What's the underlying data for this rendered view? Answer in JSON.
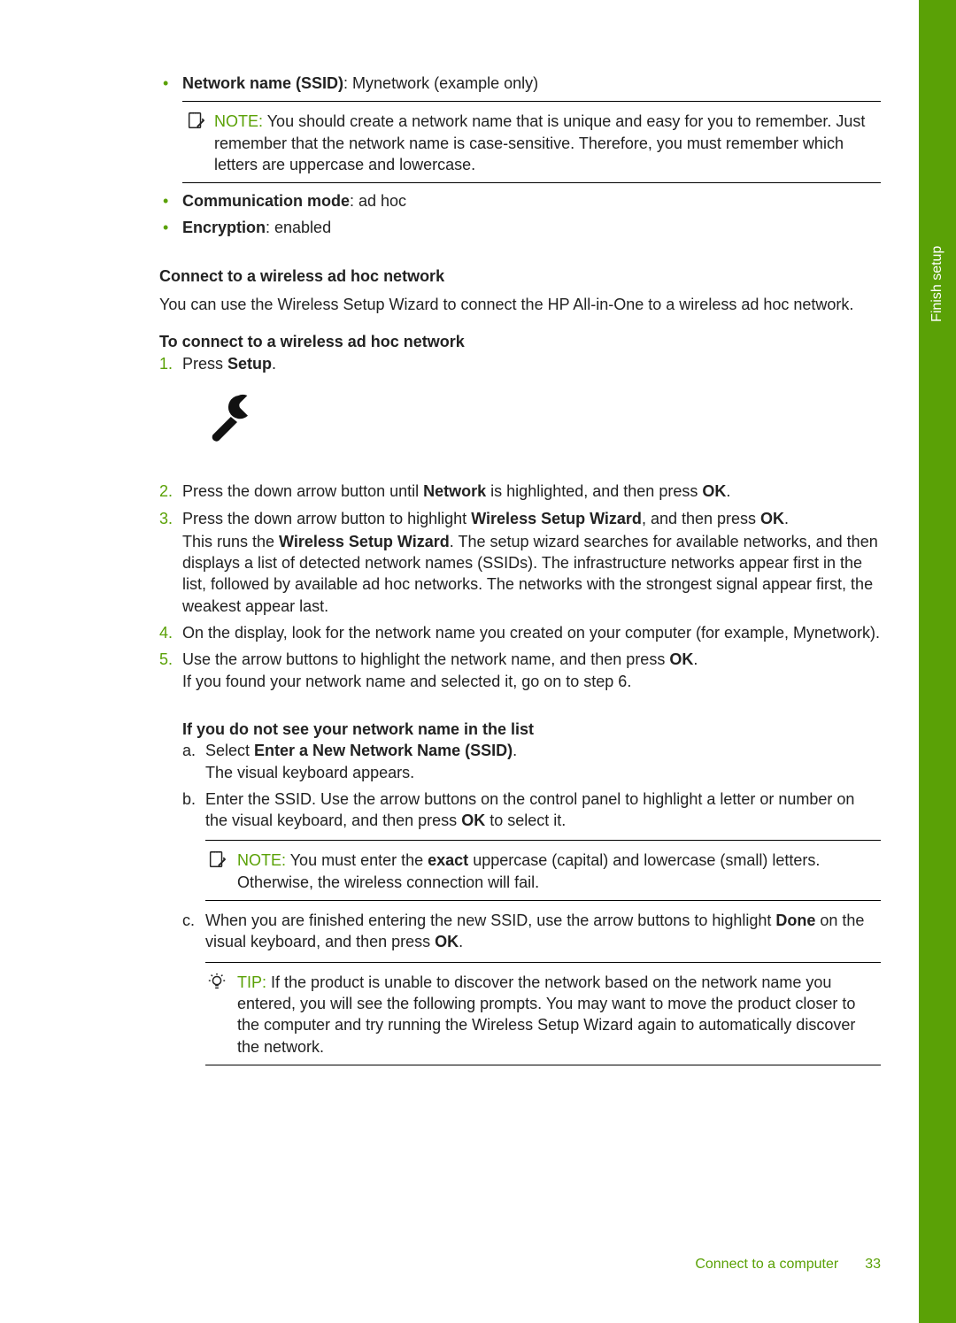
{
  "side_tab": "Finish setup",
  "top_bullets": [
    {
      "label_bold": "Network name (SSID)",
      "value": ": Mynetwork (example only)"
    }
  ],
  "note1": {
    "label": "NOTE:",
    "text": "You should create a network name that is unique and easy for you to remember. Just remember that the network name is case-sensitive. Therefore, you must remember which letters are uppercase and lowercase."
  },
  "top_bullets2": [
    {
      "label_bold": "Communication mode",
      "value": ": ad hoc"
    },
    {
      "label_bold": "Encryption",
      "value": ": enabled"
    }
  ],
  "section_heading": "Connect to a wireless ad hoc network",
  "section_para": "You can use the Wireless Setup Wizard to connect the HP All-in-One to a wireless ad hoc network.",
  "proc_heading": "To connect to a wireless ad hoc network",
  "step1_a": "Press ",
  "step1_b": "Setup",
  "step1_c": ".",
  "step2_a": "Press the down arrow button until ",
  "step2_b": "Network",
  "step2_c": " is highlighted, and then press ",
  "step2_d": "OK",
  "step2_e": ".",
  "step3_a": "Press the down arrow button to highlight ",
  "step3_b": "Wireless Setup Wizard",
  "step3_c": ", and then press ",
  "step3_d": "OK",
  "step3_e": ".",
  "step3_p2a": "This runs the ",
  "step3_p2b": "Wireless Setup Wizard",
  "step3_p2c": ". The setup wizard searches for available networks, and then displays a list of detected network names (SSIDs). The infrastructure networks appear first in the list, followed by available ad hoc networks. The networks with the strongest signal appear first, the weakest appear last.",
  "step4": "On the display, look for the network name you created on your computer (for example, Mynetwork).",
  "step5_a": "Use the arrow buttons to highlight the network name, and then press ",
  "step5_b": "OK",
  "step5_c": ".",
  "step5_p2": "If you found your network name and selected it, go on to step 6.",
  "substeps_heading": "If you do not see your network name in the list",
  "sub_a_1a": "Select ",
  "sub_a_1b": "Enter a New Network Name (SSID)",
  "sub_a_1c": ".",
  "sub_a_2": "The visual keyboard appears.",
  "sub_b_a": "Enter the SSID. Use the arrow buttons on the control panel to highlight a letter or number on the visual keyboard, and then press ",
  "sub_b_b": "OK",
  "sub_b_c": " to select it.",
  "note2": {
    "label": "NOTE:",
    "text_a": "You must enter the ",
    "text_b": "exact",
    "text_c": " uppercase (capital) and lowercase (small) letters. Otherwise, the wireless connection will fail."
  },
  "sub_c_a": "When you are finished entering the new SSID, use the arrow buttons to highlight ",
  "sub_c_b": "Done",
  "sub_c_c": " on the visual keyboard, and then press ",
  "sub_c_d": "OK",
  "sub_c_e": ".",
  "tip": {
    "label": "TIP:",
    "text": "If the product is unable to discover the network based on the network name you entered, you will see the following prompts. You may want to move the product closer to the computer and try running the Wireless Setup Wizard again to automatically discover the network."
  },
  "footer_text": "Connect to a computer",
  "footer_page": "33"
}
